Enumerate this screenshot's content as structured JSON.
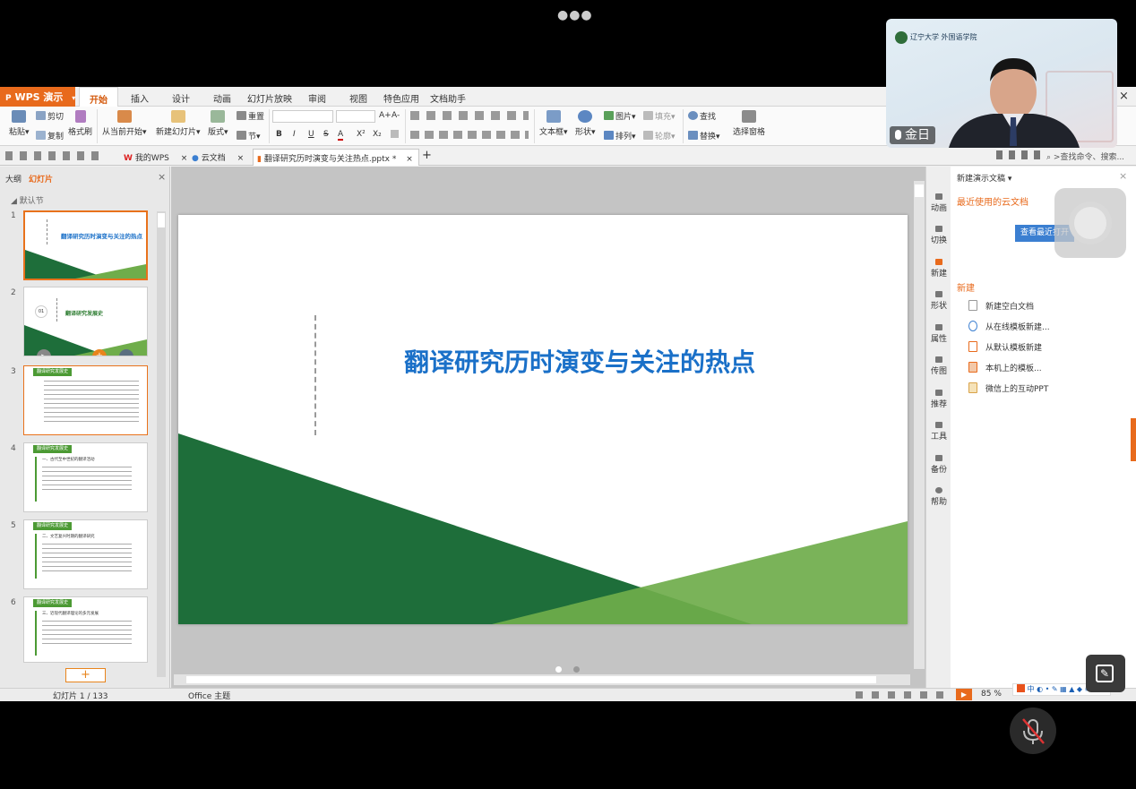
{
  "app": {
    "menu_label": "WPS 演示",
    "dropdown_glyph": "▾",
    "close_glyph": "×"
  },
  "menu_tabs": [
    "开始",
    "插入",
    "设计",
    "动画",
    "幻灯片放映",
    "审阅",
    "视图",
    "特色应用",
    "文档助手"
  ],
  "ribbon": {
    "paste": "粘贴",
    "cut": "剪切",
    "copy": "复制",
    "format_painter": "格式刷",
    "from_current": "从当前开始",
    "new_slide": "新建幻灯片",
    "layout": "版式",
    "reset": "重置",
    "section": "节",
    "grow": "A+",
    "shrink": "A-",
    "bold": "B",
    "italic": "I",
    "underline": "U",
    "strike": "S",
    "fontcolor": "A",
    "sup": "X²",
    "sub": "X₂",
    "textbox": "文本框",
    "shape": "形状",
    "picture": "图片",
    "fill": "填充",
    "arrange": "排列",
    "outline": "轮廓",
    "find": "查找",
    "replace": "替换",
    "select_pane": "选择窗格"
  },
  "doc_tabs": [
    {
      "label": "我的WPS"
    },
    {
      "label": "云文档"
    },
    {
      "label": "翻译研究历时演变与关注热点.pptx *"
    }
  ],
  "tab_glyphs": {
    "close": "×",
    "add": "+"
  },
  "search": {
    "placeholder": ">查找命令、搜索..."
  },
  "left_panel": {
    "outline_tab": "大纲",
    "slides_tab": "幻灯片",
    "section": "默认节",
    "add": "+",
    "thumbs": [
      {
        "num": "1",
        "title": "翻译研究历时演变与关注的热点"
      },
      {
        "num": "2",
        "badge": "01",
        "title": "翻译研究发展史"
      },
      {
        "num": "3",
        "header": "翻译研究发展史"
      },
      {
        "num": "4",
        "header": "翻译研究发展史",
        "heading": "一、古代至中世纪的翻译活动"
      },
      {
        "num": "5",
        "header": "翻译研究发展史",
        "heading": "二、文艺复兴时期的翻译研究"
      },
      {
        "num": "6",
        "header": "翻译研究发展史",
        "heading": "三、近现代翻译理论的多元发展"
      }
    ]
  },
  "slide": {
    "title": "翻译研究历时演变与关注的热点"
  },
  "right_toolbar": [
    "动画",
    "切换",
    "新建",
    "形状",
    "属性",
    "传图",
    "推荐",
    "工具",
    "备份",
    "帮助"
  ],
  "task_pane": {
    "title": "新建演示文稿",
    "close_glyph": "×",
    "recent_header": "最近使用的云文档",
    "view_recent": "查看最近打开",
    "new_header": "新建",
    "items": [
      "新建空白文档",
      "从在线模板新建...",
      "从默认模板新建",
      "本机上的模板...",
      "微信上的互动PPT"
    ]
  },
  "status": {
    "slide_info": "幻灯片 1 / 133",
    "theme": "Office 主题",
    "zoom": "85 %",
    "ime": "中"
  },
  "camera": {
    "name": "金日",
    "logo_text": "辽宁大学 外国语学院"
  },
  "colors": {
    "accent": "#e86a1c",
    "slide_title": "#1a70c8",
    "green_dark": "#1e6e3a",
    "green_light": "#6fad4b",
    "button": "#3b7fd1"
  }
}
